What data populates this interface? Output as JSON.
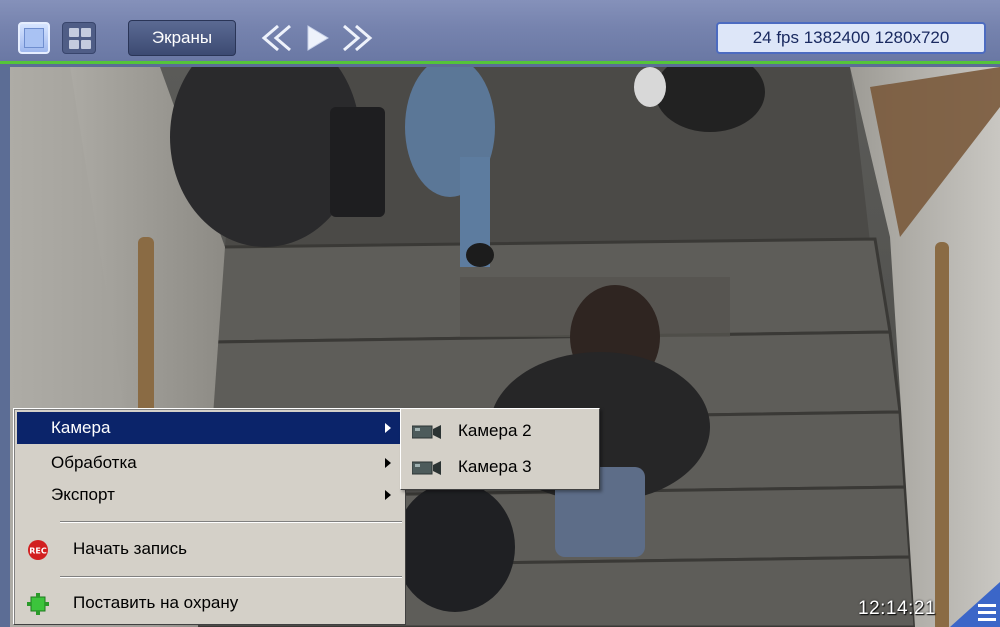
{
  "toolbar": {
    "screens_label": "Экраны",
    "fps_info": "24 fps 1382400 1280x720",
    "icons": [
      "layout-single-icon",
      "layout-quad-icon",
      "rewind-icon",
      "play-icon",
      "fast-forward-icon"
    ]
  },
  "video": {
    "timestamp": "12:14:21",
    "corner_icon": "menu-icon"
  },
  "context_menu": {
    "items": [
      {
        "label": "Камера",
        "has_submenu": true,
        "active": true
      },
      {
        "label": "Обработка",
        "has_submenu": true,
        "active": false
      },
      {
        "label": "Экспорт",
        "has_submenu": true,
        "active": false
      }
    ],
    "actions": [
      {
        "label": "Начать запись",
        "icon": "rec-icon"
      },
      {
        "label": "Поставить на охрану",
        "icon": "arm-icon"
      }
    ]
  },
  "submenu": {
    "items": [
      {
        "label": "Камера 2",
        "icon": "camera-icon"
      },
      {
        "label": "Камера 3",
        "icon": "camera-icon"
      }
    ]
  },
  "colors": {
    "toolbar": "#7683ae",
    "toolbar_accent": "#55c43a",
    "menu_bg": "#d4d0c8",
    "menu_highlight": "#0b246a",
    "fps_badge_bg": "#dde6f8"
  }
}
